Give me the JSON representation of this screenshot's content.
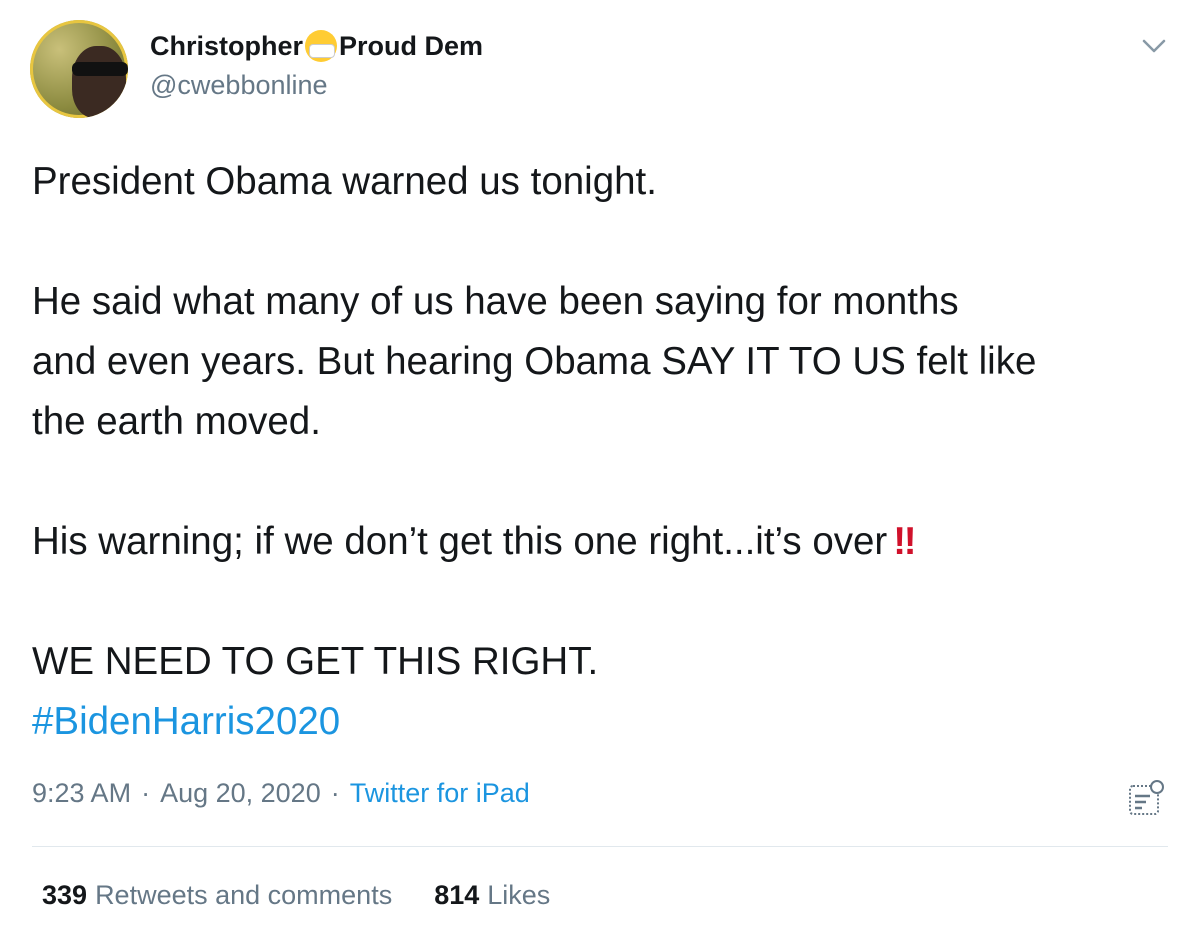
{
  "author": {
    "name": "Christopher",
    "name_suffix": "Proud Dem",
    "emoji": "face-with-medical-mask",
    "handle": "@cwebbonline"
  },
  "tweet": {
    "line1": "President Obama warned us tonight.",
    "line2": "He said what many of us have been saying for months",
    "line3": "and even years. But hearing Obama SAY IT TO US felt like",
    "line4": "the earth moved.",
    "line5": "His warning; if we don’t get this one right...it’s over",
    "line5_emoji": "‼",
    "line6": "WE NEED TO GET THIS RIGHT.",
    "hashtag": "#BidenHarris2020"
  },
  "meta": {
    "time": "9:23 AM",
    "separator": "·",
    "date": "Aug 20, 2020",
    "source": "Twitter for iPad"
  },
  "stats": {
    "retweets_count": "339",
    "retweets_label": "Retweets and comments",
    "likes_count": "814",
    "likes_label": "Likes"
  },
  "icons": {
    "more": "chevron-down-icon",
    "analytics": "analytics-icon",
    "avatar": "avatar"
  },
  "colors": {
    "link": "#1b95e0",
    "secondary": "#657786",
    "text": "#14171a",
    "exclamation": "#d0112b"
  }
}
